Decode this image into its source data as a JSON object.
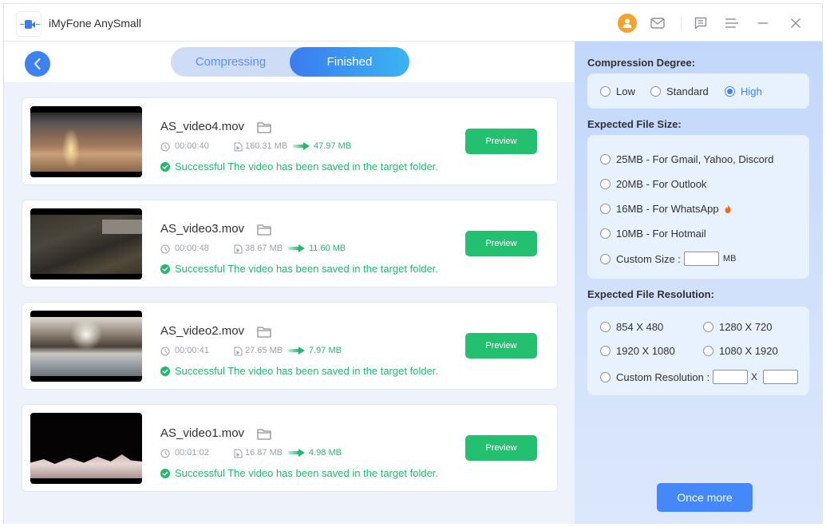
{
  "app": {
    "title": "iMyFone AnySmall",
    "window_icons": [
      "user-avatar-icon",
      "mail-icon",
      "feedback-icon",
      "menu-icon",
      "minimize-icon",
      "close-icon"
    ]
  },
  "tabs": {
    "items": [
      {
        "label": "Compressing",
        "active": false
      },
      {
        "label": "Finished",
        "active": true
      }
    ]
  },
  "videos": [
    {
      "name": "AS_video4.mov",
      "duration": "00:00:40",
      "original_size": "160.31 MB",
      "compressed_size": "47.97 MB",
      "status": "Successful The video has been saved in the target folder.",
      "button": "Preview",
      "thumb": "sunset-beach"
    },
    {
      "name": "AS_video3.mov",
      "duration": "00:00:48",
      "original_size": "38.67 MB",
      "compressed_size": "11.60 MB",
      "status": "Successful The video has been saved in the target folder.",
      "button": "Preview",
      "thumb": "stream-rocks"
    },
    {
      "name": "AS_video2.mov",
      "duration": "00:00:41",
      "original_size": "27.65 MB",
      "compressed_size": "7.97 MB",
      "status": "Successful The video has been saved in the target folder.",
      "button": "Preview",
      "thumb": "lake-grass"
    },
    {
      "name": "AS_video1.mov",
      "duration": "00:01:02",
      "original_size": "16.87 MB",
      "compressed_size": "4.98 MB",
      "status": "Successful The video has been saved in the target folder.",
      "button": "Preview",
      "thumb": "crystals"
    }
  ],
  "settings": {
    "compression": {
      "title": "Compression Degree:",
      "options": [
        "Low",
        "Standard",
        "High"
      ],
      "selected": "High"
    },
    "file_size": {
      "title": "Expected File Size:",
      "options": [
        "25MB - For Gmail, Yahoo, Discord",
        "20MB - For Outlook",
        "16MB - For WhatsApp",
        "10MB - For Hotmail"
      ],
      "custom_label": "Custom Size :",
      "custom_value": "",
      "custom_unit": "MB",
      "hot_option": "16MB - For WhatsApp"
    },
    "resolution": {
      "title": "Expected File Resolution:",
      "options": [
        "854 X 480",
        "1280 X 720",
        "1920 X 1080",
        "1080 X 1920"
      ],
      "custom_label": "Custom Resolution :",
      "custom_width": "",
      "custom_height": "",
      "separator": "X"
    },
    "once_more_label": "Once more"
  },
  "colors": {
    "accent": "#3d82f3",
    "success": "#22c06f",
    "avatar": "#f7a228",
    "hot": "#f26a1b"
  }
}
